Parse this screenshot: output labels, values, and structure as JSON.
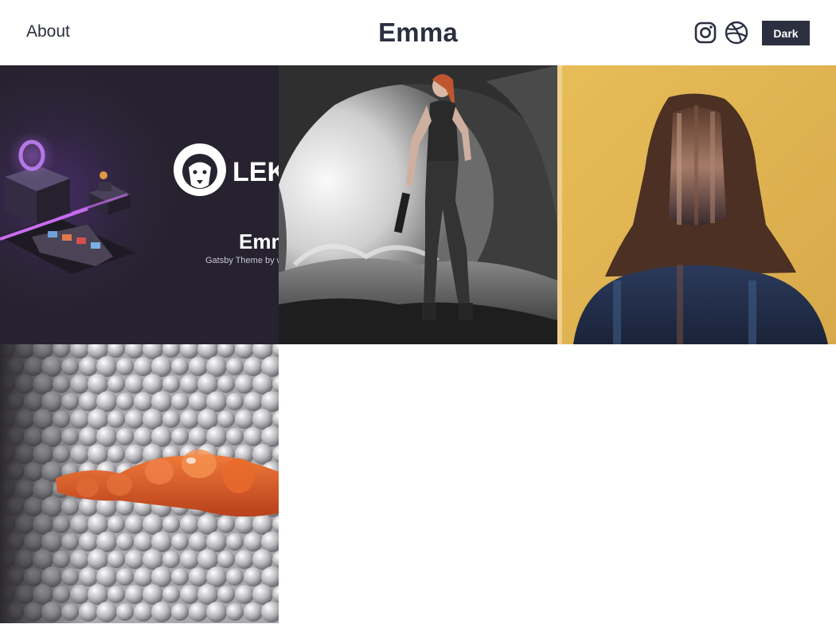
{
  "header": {
    "nav_about": "About",
    "site_title": "Emma",
    "theme_toggle_label": "Dark",
    "social_icons": [
      "instagram-icon",
      "dribbble-icon"
    ]
  },
  "colors": {
    "text_primary": "#2b2f3f",
    "button_bg": "#2b2f3f",
    "button_text": "#ffffff",
    "page_bg": "#ffffff"
  },
  "projects": [
    {
      "image": "lekoarts-emma-cover",
      "logo_text": "LEK",
      "title_text": "Emm",
      "subtitle_text": "Gatsby Theme by w"
    },
    {
      "image": "warrior-woman-cave"
    },
    {
      "image": "abstract-portrait-yellow"
    },
    {
      "image": "orange-spheres-render"
    }
  ]
}
